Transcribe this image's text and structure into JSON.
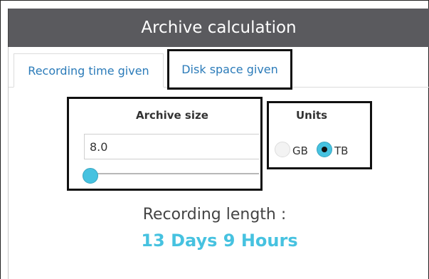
{
  "header": {
    "title": "Archive calculation"
  },
  "tabs": [
    {
      "label": "Recording time given",
      "active": true
    },
    {
      "label": "Disk space given",
      "active": false,
      "highlighted": true
    }
  ],
  "archive_size": {
    "label": "Archive size",
    "value": "8.0",
    "slider_fraction": 0.0
  },
  "units": {
    "label": "Units",
    "options": [
      {
        "label": "GB",
        "selected": false
      },
      {
        "label": "TB",
        "selected": true
      }
    ]
  },
  "result": {
    "label": "Recording length :",
    "value": "13 Days 9 Hours"
  },
  "colors": {
    "accent": "#46c2e0",
    "link": "#2b7bb9",
    "title_bar": "#5a5a5e"
  }
}
